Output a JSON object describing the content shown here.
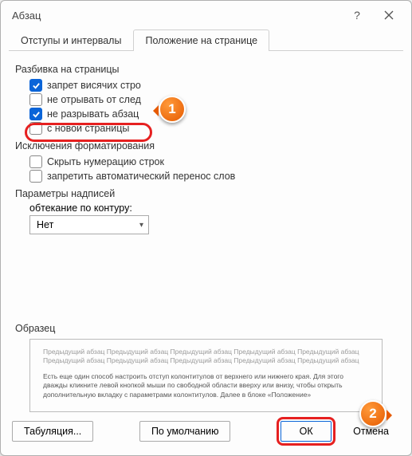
{
  "title": "Абзац",
  "tabs": {
    "indents": "Отступы и интервалы",
    "position": "Положение на странице"
  },
  "groups": {
    "pagination": "Разбивка на страницы",
    "format_exceptions": "Исключения форматирования",
    "textbox_params": "Параметры надписей"
  },
  "options": {
    "widow": "запрет висячих стро",
    "keep_next": "не отрывать от след",
    "keep_together": "не разрывать абзац",
    "page_break": "с новой страницы",
    "suppress_numbers": "Скрыть нумерацию строк",
    "no_hyphen": "запретить автоматический перенос слов"
  },
  "wrap": {
    "label": "обтекание по контуру:",
    "value": "Нет"
  },
  "preview": {
    "label": "Образец",
    "grey": "Предыдущий абзац Предыдущий абзац Предыдущий абзац Предыдущий абзац Предыдущий абзац Предыдущий абзац Предыдущий абзац Предыдущий абзац Предыдущий абзац Предыдущий абзац",
    "sample": "Есть еще один способ настроить отступ колонтитулов от верхнего или нижнего края. Для этого дважды кликните левой кнопкой мыши по свободной области вверху или внизу, чтобы открыть дополнительную вкладку с параметрами колонтитулов. Далее в блоке «Положение»"
  },
  "buttons": {
    "tabs": "Табуляция...",
    "default": "По умолчанию",
    "ok": "ОК",
    "cancel": "Отмена"
  },
  "badges": {
    "b1": "1",
    "b2": "2"
  }
}
